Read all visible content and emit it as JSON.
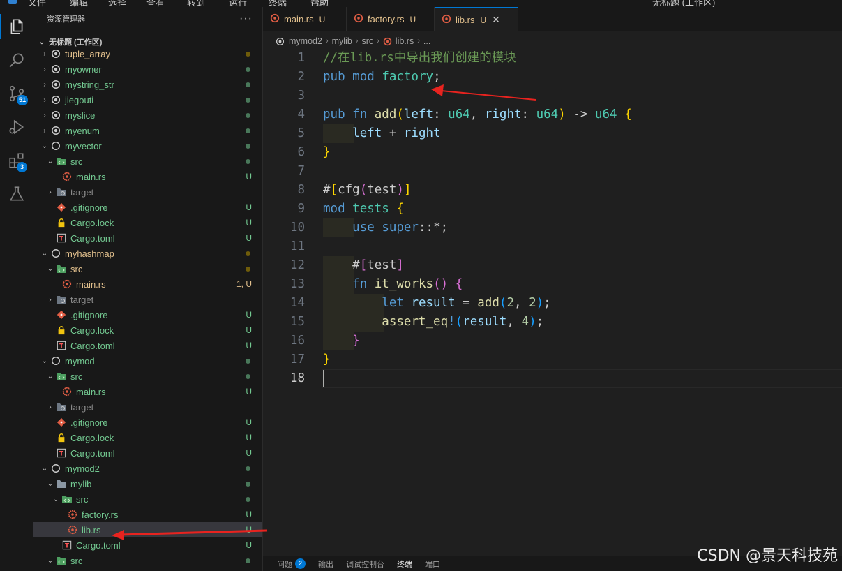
{
  "colors": {
    "accent": "#0078d4",
    "modified": "#e2c08d",
    "untracked": "#73c991",
    "dot_green": "#73c991",
    "dot_yellow": "#b89500",
    "annotation_red": "#e8231f"
  },
  "menubar": {
    "items": [
      "文件",
      "编辑",
      "选择",
      "查看",
      "转到",
      "运行",
      "终端",
      "帮助"
    ],
    "search": "无标题 (工作区)"
  },
  "activity_bar": {
    "items": [
      {
        "name": "explorer-icon",
        "badge": ""
      },
      {
        "name": "search-icon",
        "badge": ""
      },
      {
        "name": "source-control-icon",
        "badge": "51"
      },
      {
        "name": "run-debug-icon",
        "badge": ""
      },
      {
        "name": "extensions-icon",
        "badge": "3"
      },
      {
        "name": "testing-icon",
        "badge": ""
      }
    ]
  },
  "sidebar": {
    "title": "资源管理器",
    "more": "···",
    "workspace": "无标题 (工作区)",
    "items": [
      {
        "label": "tuple_array",
        "type": "project",
        "expanded": false,
        "status": "",
        "dot": "yellow",
        "color": "modified"
      },
      {
        "label": "myowner",
        "type": "project",
        "expanded": false,
        "status": "",
        "dot": "green",
        "color": "untracked"
      },
      {
        "label": "mystring_str",
        "type": "project",
        "expanded": false,
        "status": "",
        "dot": "green",
        "color": "untracked"
      },
      {
        "label": "jiegouti",
        "type": "project",
        "expanded": false,
        "status": "",
        "dot": "green",
        "color": "untracked"
      },
      {
        "label": "myslice",
        "type": "project",
        "expanded": false,
        "status": "",
        "dot": "green",
        "color": "untracked"
      },
      {
        "label": "myenum",
        "type": "project",
        "expanded": false,
        "status": "",
        "dot": "green",
        "color": "untracked"
      },
      {
        "label": "myvector",
        "type": "project-open",
        "expanded": true,
        "status": "",
        "dot": "green",
        "color": "untracked"
      },
      {
        "label": "src",
        "type": "folder-src",
        "expanded": true,
        "status": "",
        "dot": "green",
        "color": "untracked"
      },
      {
        "label": "main.rs",
        "type": "rust",
        "status": "U",
        "dot": "",
        "color": "untracked"
      },
      {
        "label": "target",
        "type": "folder-target",
        "expanded": false,
        "status": "",
        "dot": "",
        "color": "muted"
      },
      {
        "label": ".gitignore",
        "type": "git",
        "status": "U",
        "dot": "",
        "color": "untracked"
      },
      {
        "label": "Cargo.lock",
        "type": "lock",
        "status": "U",
        "dot": "",
        "color": "untracked"
      },
      {
        "label": "Cargo.toml",
        "type": "toml",
        "status": "U",
        "dot": "",
        "color": "untracked"
      },
      {
        "label": "myhashmap",
        "type": "project-open",
        "expanded": true,
        "status": "",
        "dot": "yellow",
        "color": "modified"
      },
      {
        "label": "src",
        "type": "folder-src",
        "expanded": true,
        "status": "",
        "dot": "yellow",
        "color": "modified"
      },
      {
        "label": "main.rs",
        "type": "rust",
        "status": "1, U",
        "dot": "",
        "color": "modified"
      },
      {
        "label": "target",
        "type": "folder-target",
        "expanded": false,
        "status": "",
        "dot": "",
        "color": "muted"
      },
      {
        "label": ".gitignore",
        "type": "git",
        "status": "U",
        "dot": "",
        "color": "untracked"
      },
      {
        "label": "Cargo.lock",
        "type": "lock",
        "status": "U",
        "dot": "",
        "color": "untracked"
      },
      {
        "label": "Cargo.toml",
        "type": "toml",
        "status": "U",
        "dot": "",
        "color": "untracked"
      },
      {
        "label": "mymod",
        "type": "project-open",
        "expanded": true,
        "status": "",
        "dot": "green",
        "color": "untracked"
      },
      {
        "label": "src",
        "type": "folder-src",
        "expanded": true,
        "status": "",
        "dot": "green",
        "color": "untracked"
      },
      {
        "label": "main.rs",
        "type": "rust",
        "status": "U",
        "dot": "",
        "color": "untracked"
      },
      {
        "label": "target",
        "type": "folder-target",
        "expanded": false,
        "status": "",
        "dot": "",
        "color": "muted"
      },
      {
        "label": ".gitignore",
        "type": "git",
        "status": "U",
        "dot": "",
        "color": "untracked"
      },
      {
        "label": "Cargo.lock",
        "type": "lock",
        "status": "U",
        "dot": "",
        "color": "untracked"
      },
      {
        "label": "Cargo.toml",
        "type": "toml",
        "status": "U",
        "dot": "",
        "color": "untracked"
      },
      {
        "label": "mymod2",
        "type": "project-open",
        "expanded": true,
        "status": "",
        "dot": "green",
        "color": "untracked"
      },
      {
        "label": "mylib",
        "type": "folder",
        "expanded": true,
        "status": "",
        "dot": "green",
        "color": "untracked"
      },
      {
        "label": "src",
        "type": "folder-src",
        "expanded": true,
        "status": "",
        "dot": "green",
        "color": "untracked"
      },
      {
        "label": "factory.rs",
        "type": "rust",
        "status": "U",
        "dot": "",
        "color": "untracked"
      },
      {
        "label": "lib.rs",
        "type": "rust",
        "status": "U",
        "dot": "",
        "color": "untracked",
        "selected": true
      },
      {
        "label": "Cargo.toml",
        "type": "toml",
        "status": "U",
        "dot": "",
        "color": "untracked"
      },
      {
        "label": "src",
        "type": "folder-src",
        "expanded": true,
        "status": "",
        "dot": "green",
        "color": "untracked"
      }
    ]
  },
  "tabs": [
    {
      "label": "main.rs",
      "status": "U",
      "active": false
    },
    {
      "label": "factory.rs",
      "status": "U",
      "active": false
    },
    {
      "label": "lib.rs",
      "status": "U",
      "active": true,
      "close": "✕"
    }
  ],
  "breadcrumb": [
    "mymod2",
    "mylib",
    "src",
    "lib.rs",
    "..."
  ],
  "code": {
    "current_line": 18,
    "lines": [
      [
        [
          "cm",
          "//在lib.rs中导出我们创建的模块"
        ]
      ],
      [
        [
          "kw",
          "pub "
        ],
        [
          "kw",
          "mod "
        ],
        [
          "mod",
          "factory"
        ],
        [
          "",
          ";"
        ]
      ],
      [],
      [
        [
          "kw",
          "pub "
        ],
        [
          "kw",
          "fn "
        ],
        [
          "fn",
          "add"
        ],
        [
          "br1",
          "("
        ],
        [
          "var",
          "left"
        ],
        [
          "",
          ": "
        ],
        [
          "ty",
          "u64"
        ],
        [
          "",
          ", "
        ],
        [
          "var",
          "right"
        ],
        [
          "",
          ": "
        ],
        [
          "ty",
          "u64"
        ],
        [
          "br1",
          ")"
        ],
        [
          "",
          " -> "
        ],
        [
          "ty",
          "u64"
        ],
        [
          "",
          " "
        ],
        [
          "br1",
          "{"
        ]
      ],
      [
        [
          "",
          "    "
        ],
        [
          "var",
          "left"
        ],
        [
          "",
          " + "
        ],
        [
          "var",
          "right"
        ]
      ],
      [
        [
          "br1",
          "}"
        ]
      ],
      [],
      [
        [
          "attr",
          "#"
        ],
        [
          "br1",
          "["
        ],
        [
          "attr",
          "cfg"
        ],
        [
          "br2",
          "("
        ],
        [
          "attr",
          "test"
        ],
        [
          "br2",
          ")"
        ],
        [
          "br1",
          "]"
        ]
      ],
      [
        [
          "kw",
          "mod "
        ],
        [
          "mod",
          "tests"
        ],
        [
          "",
          " "
        ],
        [
          "br1",
          "{"
        ]
      ],
      [
        [
          "",
          "    "
        ],
        [
          "kw",
          "use "
        ],
        [
          "kw",
          "super"
        ],
        [
          "",
          "::*;"
        ]
      ],
      [],
      [
        [
          "",
          "    "
        ],
        [
          "attr",
          "#"
        ],
        [
          "br2",
          "["
        ],
        [
          "attr",
          "test"
        ],
        [
          "br2",
          "]"
        ]
      ],
      [
        [
          "",
          "    "
        ],
        [
          "kw",
          "fn "
        ],
        [
          "fn",
          "it_works"
        ],
        [
          "br2",
          "()"
        ],
        [
          "",
          " "
        ],
        [
          "br2",
          "{"
        ]
      ],
      [
        [
          "",
          "        "
        ],
        [
          "kw",
          "let "
        ],
        [
          "var",
          "result"
        ],
        [
          "",
          " = "
        ],
        [
          "fn",
          "add"
        ],
        [
          "br3",
          "("
        ],
        [
          "num",
          "2"
        ],
        [
          "",
          ", "
        ],
        [
          "num",
          "2"
        ],
        [
          "br3",
          ")"
        ],
        [
          "",
          ";"
        ]
      ],
      [
        [
          "",
          "        "
        ],
        [
          "fn",
          "assert_eq"
        ],
        [
          "mac",
          "!"
        ],
        [
          "br3",
          "("
        ],
        [
          "var",
          "result"
        ],
        [
          "",
          ", "
        ],
        [
          "num",
          "4"
        ],
        [
          "br3",
          ")"
        ],
        [
          "",
          ";"
        ]
      ],
      [
        [
          "",
          "    "
        ],
        [
          "br2",
          "}"
        ]
      ],
      [
        [
          "br1",
          "}"
        ]
      ],
      []
    ]
  },
  "panel": {
    "tabs": [
      {
        "label": "问题",
        "badge": "2"
      },
      {
        "label": "输出",
        "badge": ""
      },
      {
        "label": "调试控制台",
        "badge": ""
      },
      {
        "label": "终端",
        "badge": "",
        "active": true
      },
      {
        "label": "端口",
        "badge": ""
      }
    ]
  },
  "watermark": "CSDN @景天科技苑"
}
